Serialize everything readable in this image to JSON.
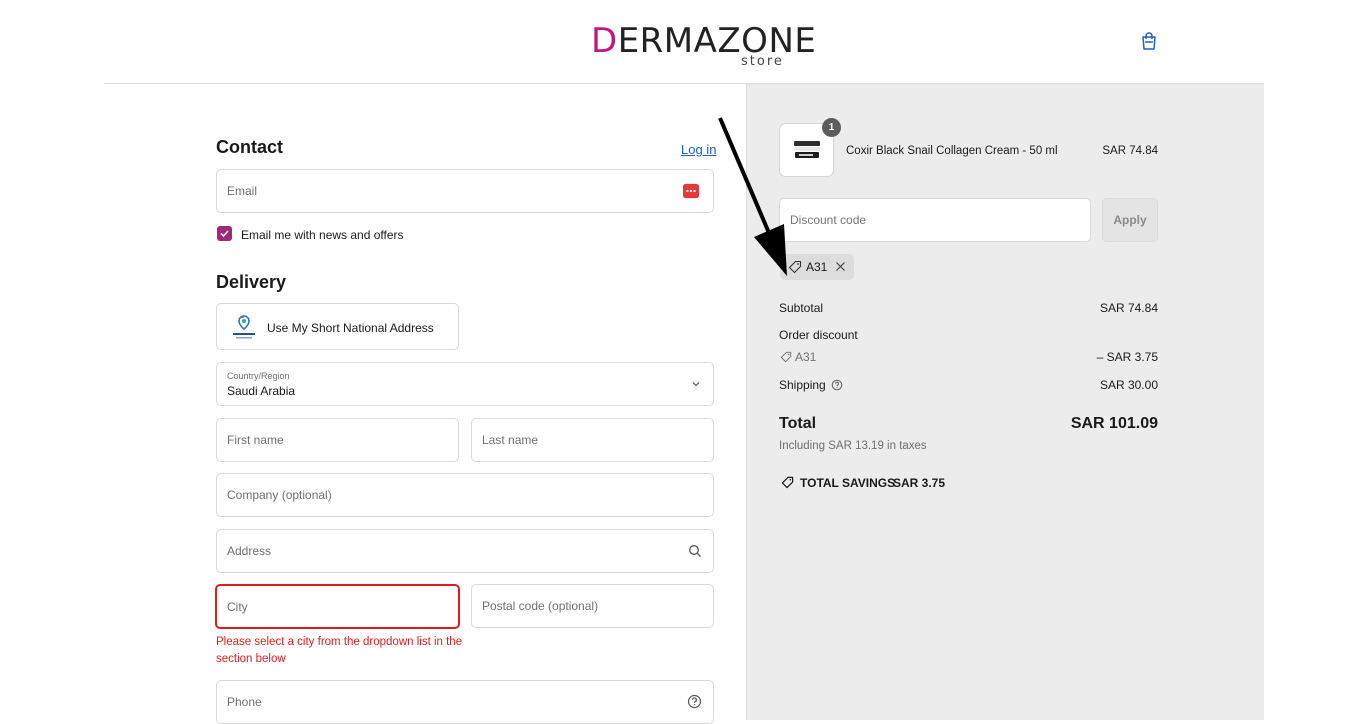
{
  "header": {
    "logo_main": "ERMAZONE",
    "logo_initial": "D",
    "logo_sub": "store"
  },
  "contact": {
    "title": "Contact",
    "login_link": "Log in",
    "email_placeholder": "Email",
    "newsletter_label": "Email me with news and offers",
    "newsletter_checked": true
  },
  "delivery": {
    "title": "Delivery",
    "national_address_button": "Use My Short National Address",
    "country_label": "Country/Region",
    "country_value": "Saudi Arabia",
    "first_name_placeholder": "First name",
    "last_name_placeholder": "Last name",
    "company_placeholder": "Company (optional)",
    "address_placeholder": "Address",
    "city_placeholder": "City",
    "postal_placeholder": "Postal code (optional)",
    "city_error": "Please select a city from the dropdown list in the section below",
    "phone_placeholder": "Phone"
  },
  "order": {
    "quantity": "1",
    "product_name": "Coxir Black Snail Collagen Cream - 50 ml",
    "product_price": "SAR 74.84",
    "discount_placeholder": "Discount code",
    "apply_label": "Apply",
    "applied_code": "A31",
    "subtotal_label": "Subtotal",
    "subtotal_value": "SAR 74.84",
    "order_discount_label": "Order discount",
    "discount_code_label": "A31",
    "discount_value": "– SAR 3.75",
    "shipping_label": "Shipping",
    "shipping_value": "SAR 30.00",
    "total_label": "Total",
    "total_value": "SAR 101.09",
    "taxes_note": "Including SAR 13.19 in taxes",
    "savings_label": "TOTAL SAVINGS",
    "savings_value": "SAR 3.75"
  },
  "colors": {
    "brand": "#c01880",
    "checkbox": "#a0267e",
    "error": "#dd1d1d",
    "link": "#1f5fbf"
  }
}
